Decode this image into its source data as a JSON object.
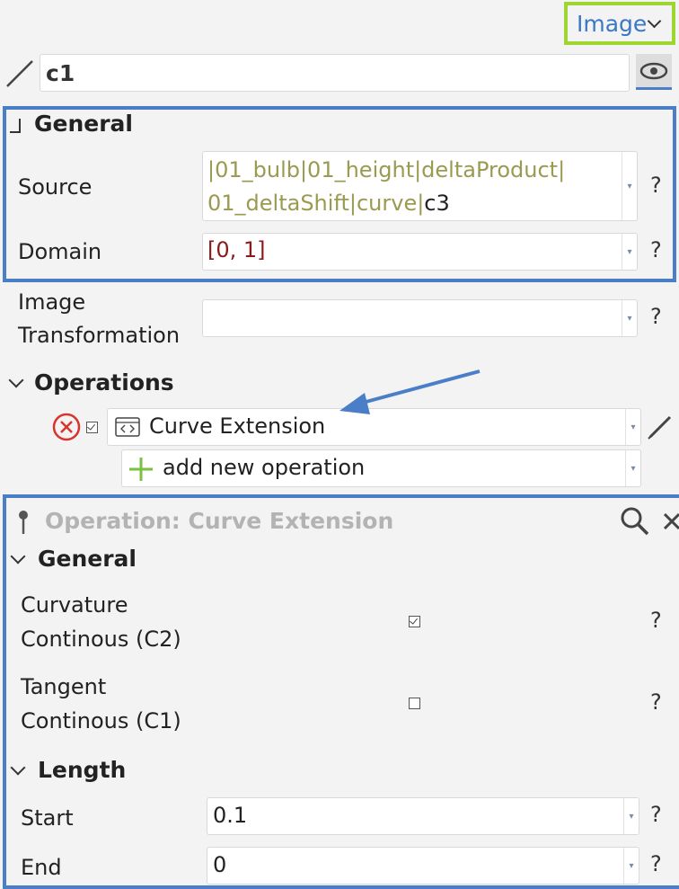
{
  "header": {
    "dropdown_label": "Image"
  },
  "object": {
    "name": "c1"
  },
  "general": {
    "title": "General",
    "source_label": "Source",
    "source_path": "|01_bulb|01_height|deltaProduct|",
    "source_path2": "01_deltaShift|curve|",
    "source_leaf": "c3",
    "domain_label": "Domain",
    "domain_value": "[0, 1]"
  },
  "image_transformation": {
    "label_line1": "Image",
    "label_line2": "Transformation",
    "value": ""
  },
  "operations": {
    "title": "Operations",
    "item_label": "Curve Extension",
    "add_label": "add new operation"
  },
  "operation_panel": {
    "title": "Operation: Curve Extension",
    "general_title": "General",
    "curvature_line1": "Curvature",
    "curvature_line2": "Continous (C2)",
    "curvature_checked": true,
    "tangent_line1": "Tangent",
    "tangent_line2": "Continous (C1)",
    "tangent_checked": false,
    "length_title": "Length",
    "start_label": "Start",
    "start_value": "0.1",
    "end_label": "End",
    "end_value": "0"
  },
  "help_symbol": "?",
  "colors": {
    "accent_blue": "#4a7fc8",
    "highlight_green": "#9ed62f",
    "path_olive": "#9a9a50",
    "domain_red": "#8b1a1a"
  }
}
